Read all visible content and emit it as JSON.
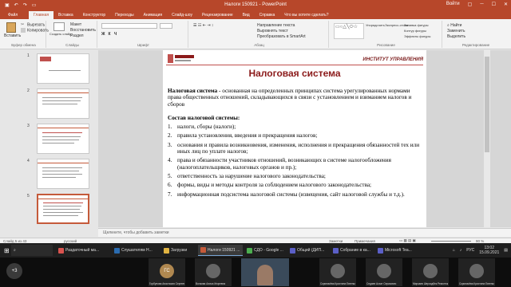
{
  "window": {
    "title": "Налоги 150921  -  PowerPoint",
    "user": "Войти"
  },
  "tabs": [
    "Файл",
    "Главная",
    "Вставка",
    "Конструктор",
    "Переходы",
    "Анимация",
    "Слайд-шоу",
    "Рецензирование",
    "Вид",
    "Справка",
    "Что вы хотите сделать?"
  ],
  "ribbon": {
    "clipboard": {
      "paste": "Вставить",
      "cut": "Вырезать",
      "copy": "Копировать",
      "format": "Формат по образцу",
      "label": "Буфер обмена"
    },
    "slides": {
      "new": "Создать слайд",
      "layout": "Макет",
      "reset": "Восстановить",
      "section": "Раздел",
      "label": "Слайды"
    },
    "font": {
      "label": "Шрифт"
    },
    "paragraph": {
      "direction": "Направление текста",
      "align": "Выровнять текст",
      "smartart": "Преобразовать в SmartArt",
      "label": "Абзац"
    },
    "drawing": {
      "arrange": "Упорядочить",
      "styles": "Экспресс-стили",
      "fill": "Заливка фигуры",
      "outline": "Контур фигуры",
      "effects": "Эффекты фигуры",
      "label": "Рисование"
    },
    "editing": {
      "find": "Найти",
      "replace": "Заменить",
      "select": "Выделить",
      "label": "Редактирование"
    }
  },
  "thumbnails": [
    {
      "num": "1"
    },
    {
      "num": "2"
    },
    {
      "num": "3"
    },
    {
      "num": "4"
    },
    {
      "num": "5"
    }
  ],
  "slide": {
    "institute": "ИНСТИТУТ УПРАВЛЕНИЯ",
    "title": "Налоговая система",
    "definition_term": "Налоговая система",
    "definition_text": " - основанная на определенных принципах система урегулированных нормами права общественных отношений, складывающихся в связи с установлением и взиманием налогов и сборов",
    "subhead": "Состав налоговой системы:",
    "items": [
      {
        "n": "1.",
        "text": "налоги, сборы (налоги);"
      },
      {
        "n": "2.",
        "text": "правила установления, введения и прекращения налогов;"
      },
      {
        "n": "3.",
        "text": "основания и правила возникновения, изменения, исполнения и прекращения обязанностей тех или иных лиц по уплате налогов;"
      },
      {
        "n": "4.",
        "text": "права и обязанности участников отношений, возникающих в системе налогообложения (налогоплательщиков, налоговых органов и пр.);"
      },
      {
        "n": "5.",
        "text": "ответственность за нарушение налогового законодательства;"
      },
      {
        "n": "6.",
        "text": "формы, виды и методы контроля за соблюдением налогового законодательства;"
      },
      {
        "n": "7.",
        "text": "информационная подсистема налоговой системы (извещения, сайт налоговой службы и т.д.)."
      }
    ]
  },
  "notes_placeholder": "Щелкните, чтобы добавить заметки",
  "statusbar": {
    "slide_info": "Слайд 5 из 43",
    "lang": "русский",
    "notes": "Заметки",
    "comments": "Примечания",
    "zoom": "90 %"
  },
  "taskbar": {
    "items": [
      {
        "label": "Раздаточный ма...",
        "color": "#d9534f"
      },
      {
        "label": "Слушателям Н...",
        "color": "#2b6cb0"
      },
      {
        "label": "Загрузки",
        "color": "#e0b341"
      },
      {
        "label": "Налоги 150921 ...",
        "color": "#c55a3a"
      },
      {
        "label": "СДО - Google ...",
        "color": "#4caf50"
      },
      {
        "label": "Общий (ДИП...",
        "color": "#5b5fc7"
      },
      {
        "label": "Собрание в ка...",
        "color": "#5b5fc7"
      },
      {
        "label": "Microsoft Tea...",
        "color": "#5b5fc7"
      }
    ],
    "lang": "РУС",
    "time": "13:02",
    "date": "15.09.2021"
  },
  "video": {
    "more": "+3",
    "tiles": [
      {
        "name": "Горбунова Анастасия Сергеевна",
        "initials": "ГС",
        "color": "#b08850"
      },
      {
        "name": "Волкова Алиса Игоревна",
        "initials": "",
        "color": "#555"
      },
      {
        "name": "Скрипачёва Кристина Евгеньевна",
        "initials": "",
        "color": "#555"
      },
      {
        "name": "Седаев Асхат Серикович",
        "initials": "",
        "color": "#555"
      },
      {
        "name": "Мирзаев Шерзодбек Ремонтжонович",
        "initials": "",
        "color": "#555"
      },
      {
        "name": "Скрипачёва Кристина Евгеньевна",
        "initials": "",
        "color": "#555"
      }
    ]
  }
}
